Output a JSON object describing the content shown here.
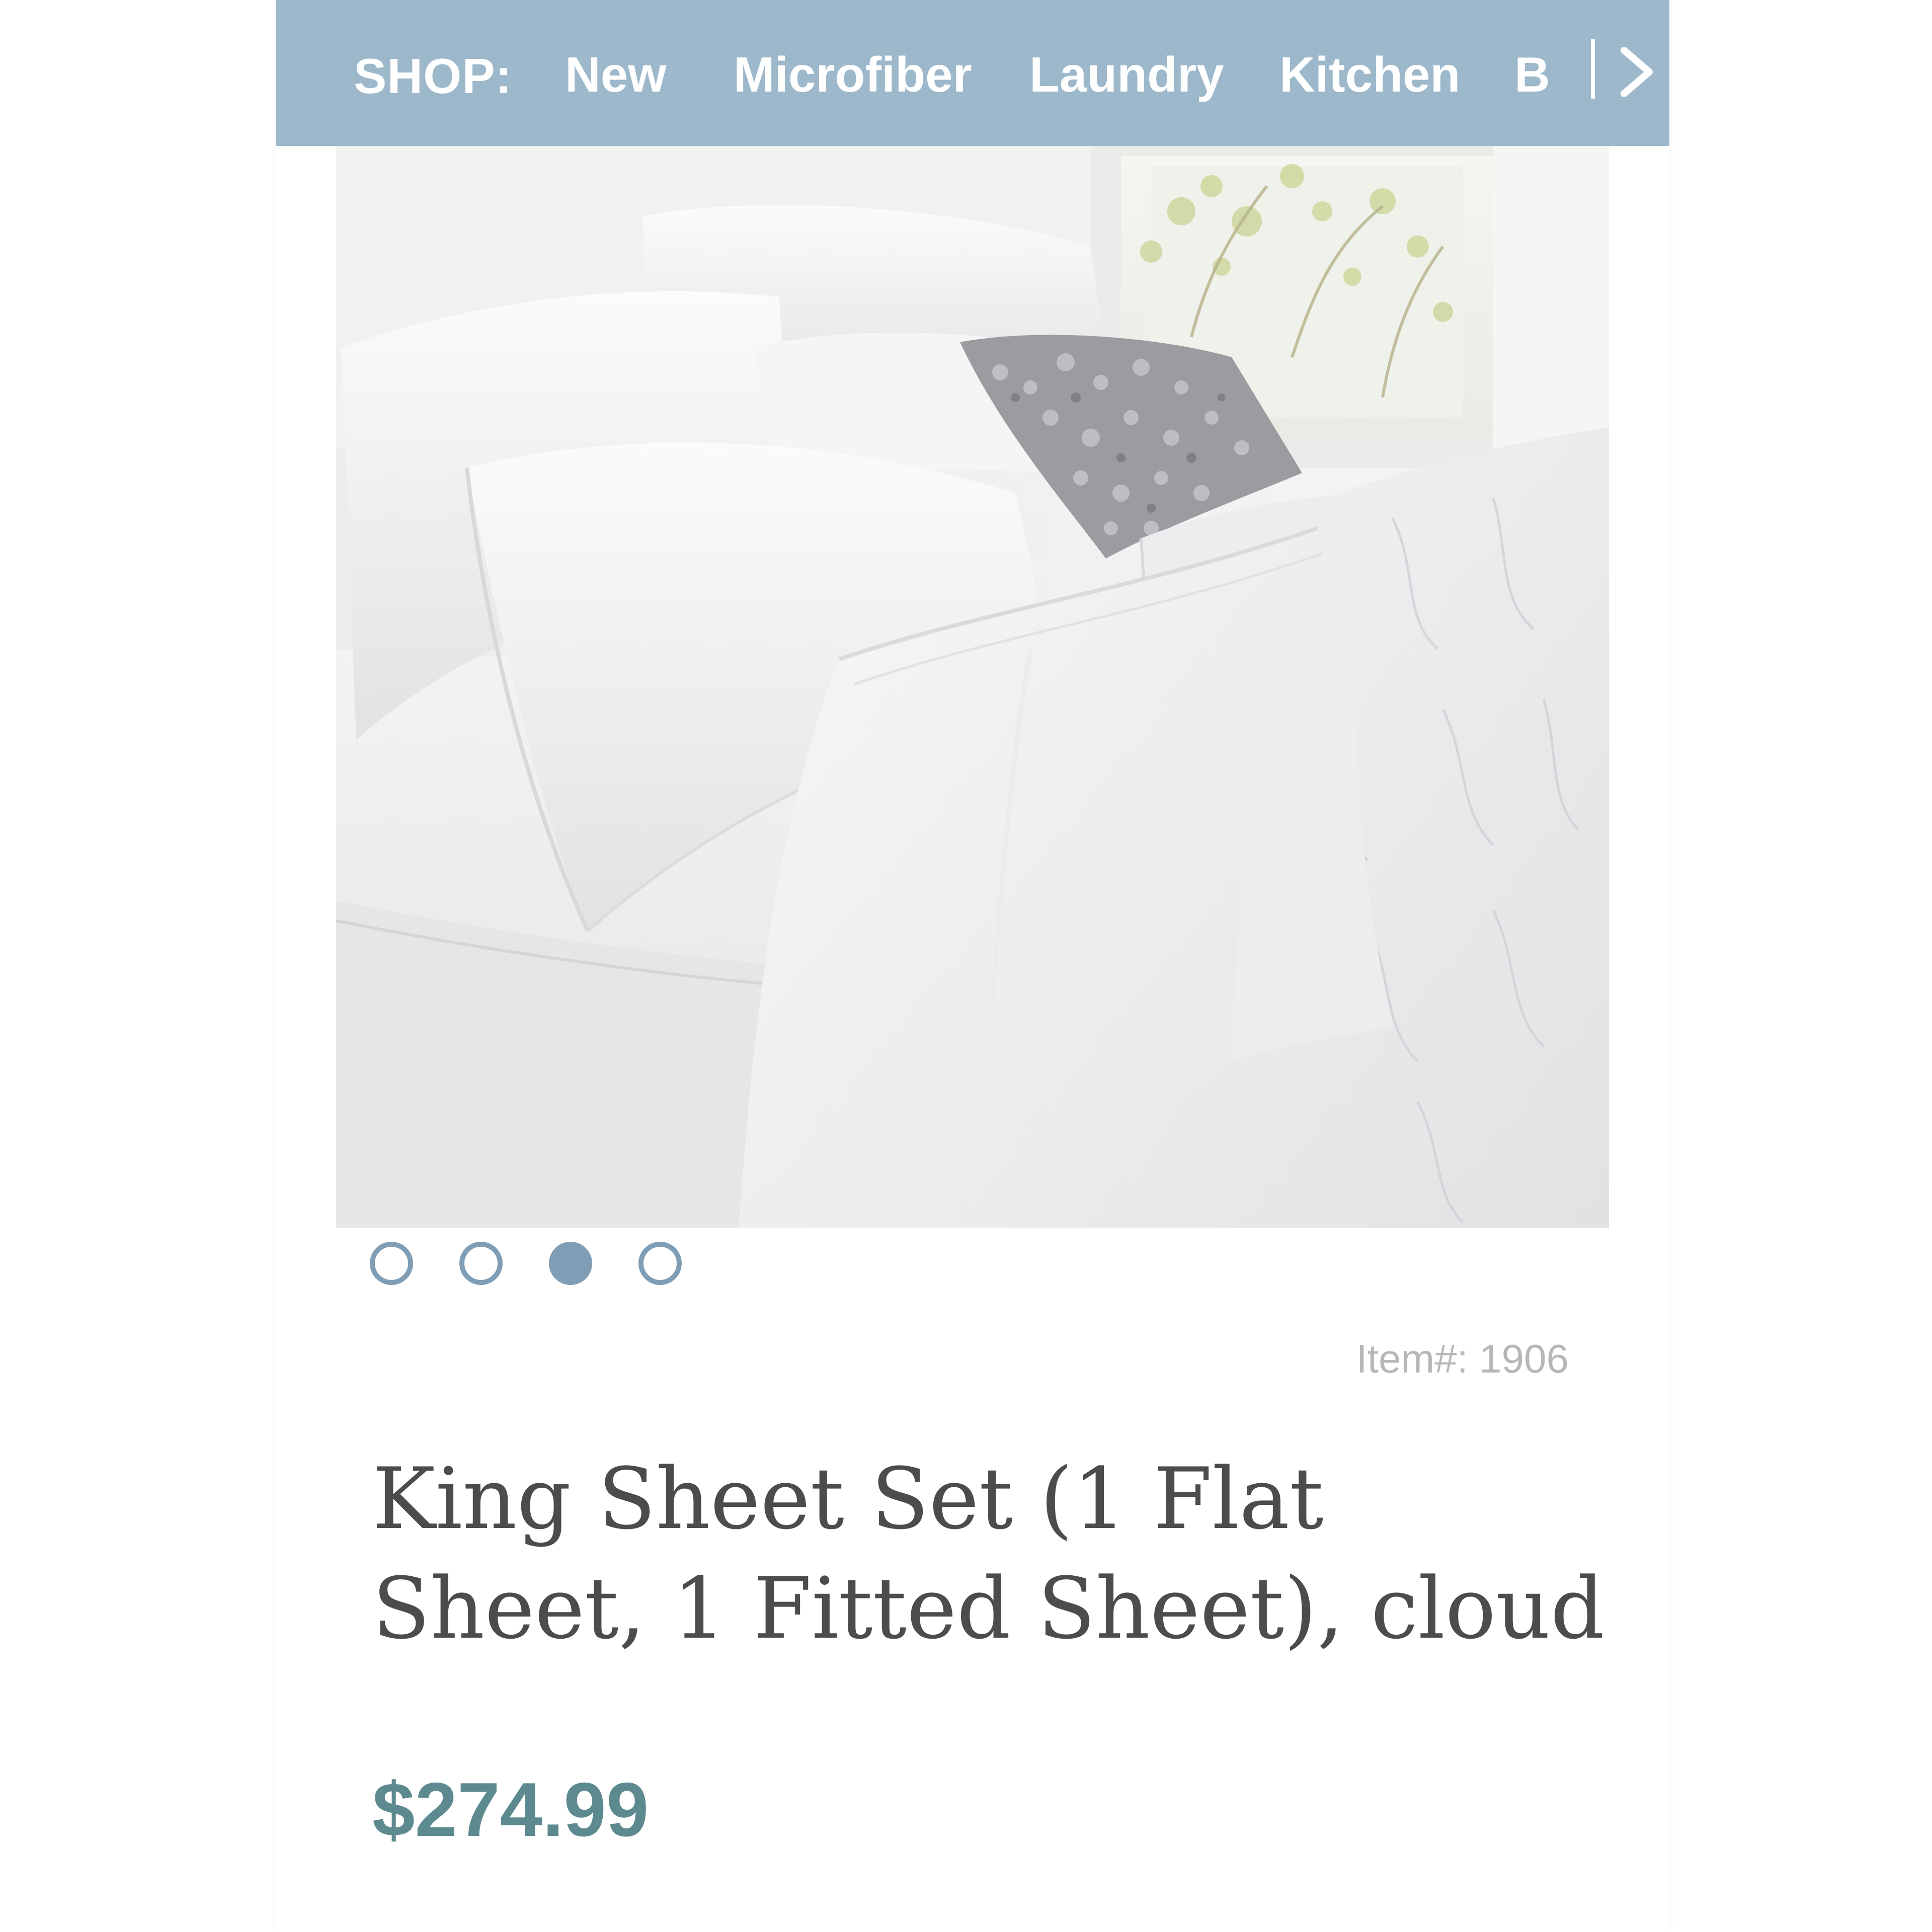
{
  "shop_nav": {
    "label": "SHOP:",
    "items": [
      "New",
      "Microfiber",
      "Laundry",
      "Kitchen",
      "B"
    ],
    "next_icon": "chevron-right-icon",
    "background_color": "#9db8cb"
  },
  "product": {
    "image_alt": "White sheets and pillows on a bed",
    "carousel": {
      "count": 4,
      "active_index": 2,
      "accent_color": "#7f9db4"
    },
    "item_number": "Item#: 1906",
    "title": "King Sheet Set (1 Flat Sheet, 1 Fitted Sheet), cloud",
    "price": "$274.99",
    "price_color": "#5d8a8f"
  }
}
